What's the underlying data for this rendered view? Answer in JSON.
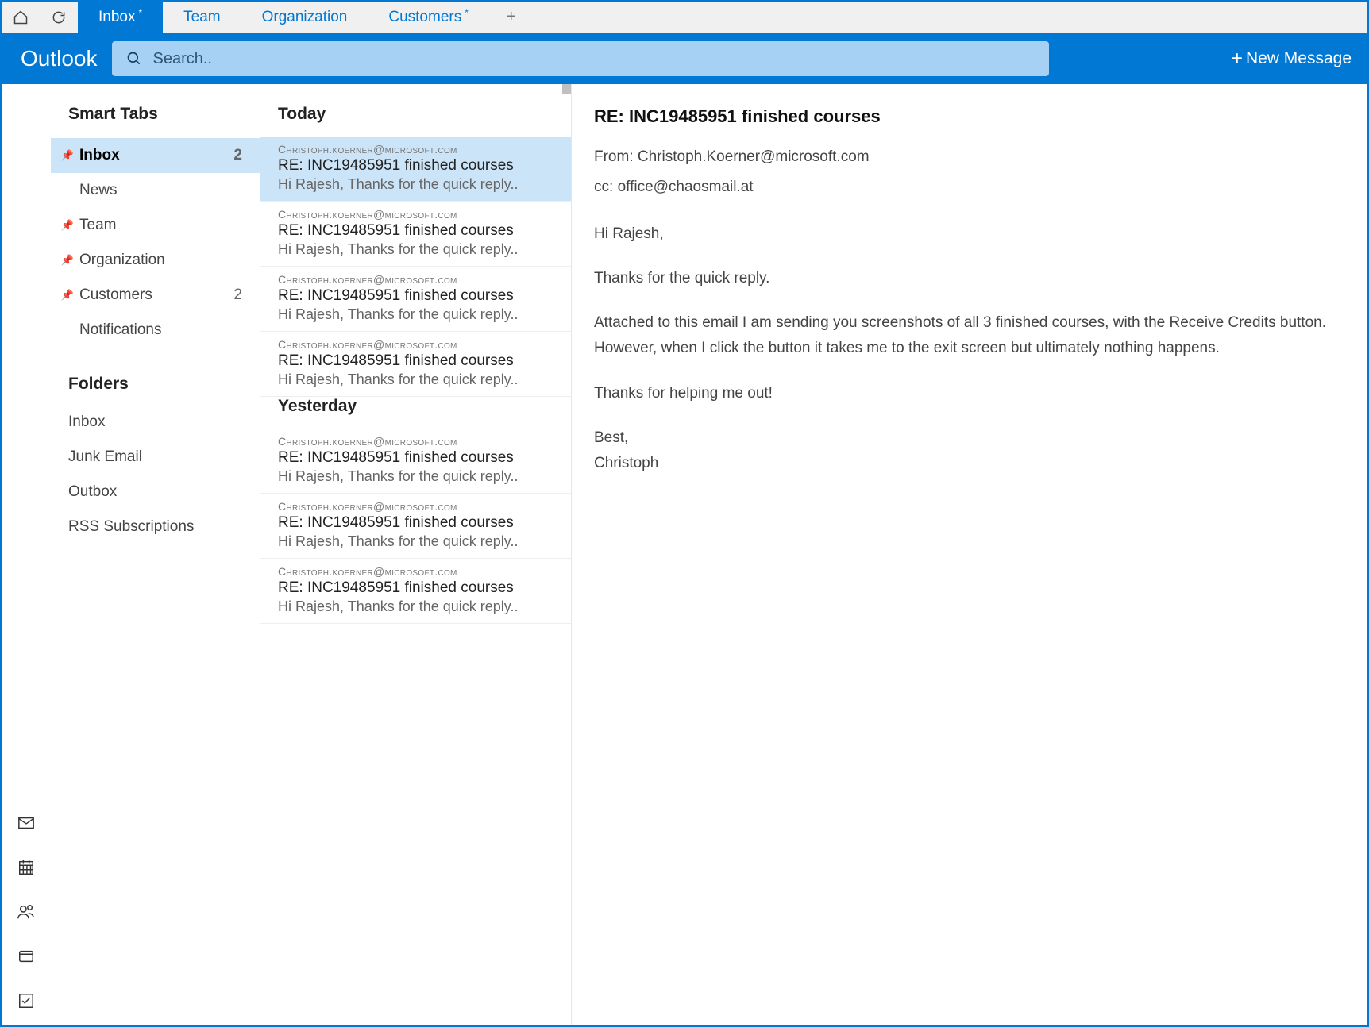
{
  "tabs": [
    {
      "label": "Inbox",
      "dirty": true,
      "active": true
    },
    {
      "label": "Team",
      "dirty": false,
      "active": false
    },
    {
      "label": "Organization",
      "dirty": false,
      "active": false
    },
    {
      "label": "Customers",
      "dirty": true,
      "active": false
    }
  ],
  "app": {
    "title": "Outlook"
  },
  "search": {
    "placeholder": "Search.."
  },
  "newMessage": {
    "label": "New Message"
  },
  "sidebar": {
    "smartTabsHeader": "Smart Tabs",
    "items": [
      {
        "label": "Inbox",
        "pinned": true,
        "count": "2",
        "selected": true
      },
      {
        "label": "News",
        "pinned": false,
        "indent": true
      },
      {
        "label": "Team",
        "pinned": true
      },
      {
        "label": "Organization",
        "pinned": true
      },
      {
        "label": "Customers",
        "pinned": true,
        "count": "2"
      },
      {
        "label": "Notifications",
        "pinned": false,
        "indent": true
      }
    ],
    "foldersHeader": "Folders",
    "folders": [
      {
        "label": "Inbox"
      },
      {
        "label": "Junk Email"
      },
      {
        "label": "Outbox"
      },
      {
        "label": "RSS Subscriptions"
      }
    ]
  },
  "messageList": {
    "groups": [
      {
        "header": "Today",
        "messages": [
          {
            "from": "Christoph.Koerner@microsoft.com",
            "subject": "RE: INC19485951 finished courses",
            "preview": "Hi Rajesh, Thanks for the quick reply..",
            "selected": true
          },
          {
            "from": "Christoph.Koerner@microsoft.com",
            "subject": "RE: INC19485951 finished courses",
            "preview": "Hi Rajesh, Thanks for the quick reply.."
          },
          {
            "from": "Christoph.Koerner@microsoft.com",
            "subject": "RE: INC19485951 finished courses",
            "preview": "Hi Rajesh, Thanks for the quick reply.."
          },
          {
            "from": "Christoph.Koerner@microsoft.com",
            "subject": "RE: INC19485951 finished courses",
            "preview": "Hi Rajesh, Thanks for the quick reply.."
          }
        ]
      },
      {
        "header": "Yesterday",
        "messages": [
          {
            "from": "Christoph.Koerner@microsoft.com",
            "subject": "RE: INC19485951 finished courses",
            "preview": "Hi Rajesh, Thanks for the quick reply.."
          },
          {
            "from": "Christoph.Koerner@microsoft.com",
            "subject": "RE: INC19485951 finished courses",
            "preview": "Hi Rajesh, Thanks for the quick reply.."
          },
          {
            "from": "Christoph.Koerner@microsoft.com",
            "subject": "RE: INC19485951 finished courses",
            "preview": "Hi Rajesh, Thanks for the quick reply.."
          }
        ]
      }
    ]
  },
  "reading": {
    "subject": "RE: INC19485951 finished courses",
    "fromLabel": "From: ",
    "from": "Christoph.Koerner@microsoft.com",
    "ccLabel": "cc: ",
    "cc": "office@chaosmail.at",
    "p1": "Hi Rajesh,",
    "p2": "Thanks for the quick reply.",
    "p3": "Attached to this email I am sending you screenshots of all 3 finished courses, with the Receive Credits button. However, when I click the button it takes me to the exit screen but ultimately nothing happens.",
    "p4": "Thanks for helping me out!",
    "p5a": "Best,",
    "p5b": "Christoph"
  }
}
